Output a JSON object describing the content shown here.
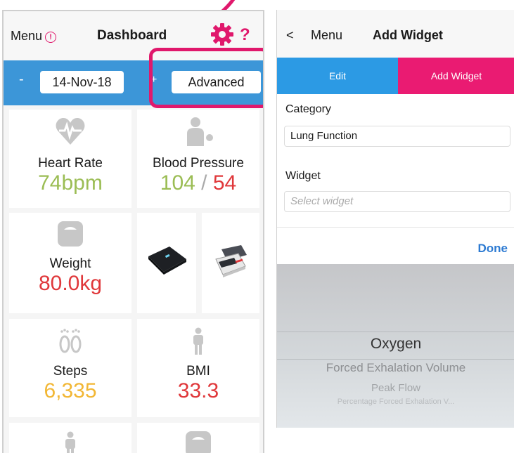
{
  "left": {
    "nav": {
      "menu_label": "Menu",
      "alert_glyph": "!",
      "title": "Dashboard",
      "help_glyph": "?"
    },
    "date_bar": {
      "minus_label": "-",
      "date_value": "14-Nov-18",
      "plus_label": "+",
      "advanced_label": "Advanced"
    },
    "tiles": {
      "heart_rate": {
        "label": "Heart Rate",
        "value": "74bpm"
      },
      "blood_pressure": {
        "label": "Blood Pressure",
        "systolic": "104",
        "separator": "/",
        "diastolic": "54"
      },
      "weight": {
        "label": "Weight",
        "value": "80.0kg"
      },
      "steps": {
        "label": "Steps",
        "value": "6,335"
      },
      "bmi": {
        "label": "BMI",
        "value": "33.3"
      }
    },
    "colors": {
      "blue_bar": "#3c96d8",
      "green": "#9bbd54",
      "red": "#e0383b",
      "orange": "#f2b735",
      "accent_pink": "#e0186c"
    },
    "icons": [
      "alert-circle-icon",
      "gear-icon",
      "help-icon",
      "heart-icon",
      "person-icon",
      "scale-icon",
      "footprints-icon",
      "standing-person-icon"
    ]
  },
  "right": {
    "nav": {
      "back_glyph": "<",
      "menu_label": "Menu",
      "title": "Add Widget"
    },
    "tabs": {
      "edit_label": "Edit",
      "add_widget_label": "Add Widget"
    },
    "form": {
      "category_label": "Category",
      "category_value": "Lung Function",
      "widget_label": "Widget",
      "widget_placeholder": "Select widget",
      "done_label": "Done"
    },
    "picker": {
      "options": [
        "Oxygen",
        "Forced Exhalation Volume",
        "Peak Flow",
        "Percentage Forced Exhalation V..."
      ]
    },
    "colors": {
      "tab_blue": "#2c9ae4",
      "tab_pink": "#ea1b72",
      "done_blue": "#2c7ad2"
    }
  }
}
